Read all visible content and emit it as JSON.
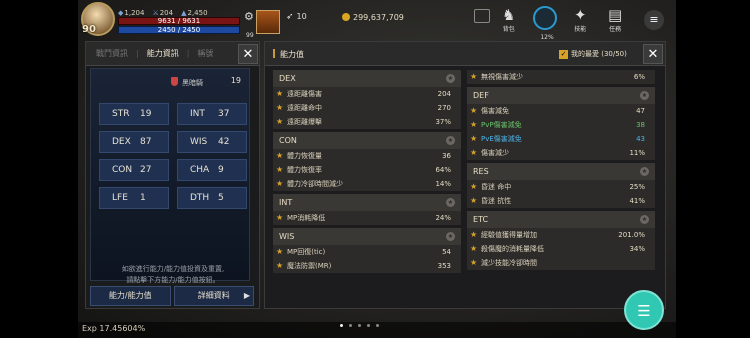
{
  "hud": {
    "level": "90",
    "stat_a": "1,204",
    "stat_b": "204",
    "stat_c": "2,450",
    "hp": "9631 / 9631",
    "mp": "2450 / 2450",
    "potion_count": "99",
    "feather_count": "10",
    "gold": "299,637,709",
    "menu_a_label": "背包",
    "circle_label": "12%",
    "skills_label": "技能",
    "quest_label": "任務"
  },
  "left_panel": {
    "tabs": [
      "戰鬥資訊",
      "能力資訊",
      "稱號"
    ],
    "badge_label": "黑暗騎",
    "badge_value": "19",
    "stats": [
      {
        "key": "STR",
        "value": "19"
      },
      {
        "key": "INT",
        "value": "37"
      },
      {
        "key": "DEX",
        "value": "87"
      },
      {
        "key": "WIS",
        "value": "42"
      },
      {
        "key": "CON",
        "value": "27"
      },
      {
        "key": "CHA",
        "value": "9"
      },
      {
        "key": "LFE",
        "value": "1"
      },
      {
        "key": "DTH",
        "value": "5"
      }
    ],
    "hint_line1": "如欲進行能力/能力值投資及重置,",
    "hint_line2": "請點擊下方能力/能力值按鈕。",
    "btn_ability": "能力/能力值",
    "btn_detail": "詳細資料"
  },
  "right_panel": {
    "title": "能力值",
    "favorite": "我的最愛 (30/50)",
    "left_sections": [
      {
        "name": "DEX",
        "rows": [
          {
            "label": "遠距離傷害",
            "value": "204"
          },
          {
            "label": "遠距離命中",
            "value": "270"
          },
          {
            "label": "遠距離爆擊",
            "value": "37%"
          }
        ]
      },
      {
        "name": "CON",
        "rows": [
          {
            "label": "體力恢復量",
            "value": "36"
          },
          {
            "label": "體力恢復率",
            "value": "64%"
          },
          {
            "label": "體力冷卻時間減少",
            "value": "14%"
          }
        ]
      },
      {
        "name": "INT",
        "rows": [
          {
            "label": "MP消耗降低",
            "value": "24%"
          }
        ]
      },
      {
        "name": "WIS",
        "rows": [
          {
            "label": "MP回復(tic)",
            "value": "54"
          },
          {
            "label": "魔法防禦(MR)",
            "value": "353"
          }
        ]
      }
    ],
    "right_sections": [
      {
        "name": "",
        "rows": [
          {
            "label": "無視傷害減少",
            "value": "6%"
          }
        ]
      },
      {
        "name": "DEF",
        "rows": [
          {
            "label": "傷害減免",
            "value": "47",
            "tone": "normal"
          },
          {
            "label": "PvP傷害減免",
            "value": "38",
            "tone": "green"
          },
          {
            "label": "PvE傷害減免",
            "value": "43",
            "tone": "blue"
          },
          {
            "label": "傷害減少",
            "value": "11%",
            "tone": "normal"
          }
        ]
      },
      {
        "name": "RES",
        "rows": [
          {
            "label": "昏迷 命中",
            "value": "25%"
          },
          {
            "label": "昏迷 抗性",
            "value": "41%"
          }
        ]
      },
      {
        "name": "ETC",
        "rows": [
          {
            "label": "經驗值獲得量增加",
            "value": "201.0%"
          },
          {
            "label": "殺傷魔的消耗量降低",
            "value": "34%"
          },
          {
            "label": "減少技能冷卻時間",
            "value": ""
          }
        ]
      }
    ]
  },
  "exp": "Exp 17.45604%",
  "colors": {
    "accent": "#d7a22a",
    "pvp": "#6bc46b",
    "pve": "#4fb3e8",
    "fab": "#31c8b3"
  }
}
